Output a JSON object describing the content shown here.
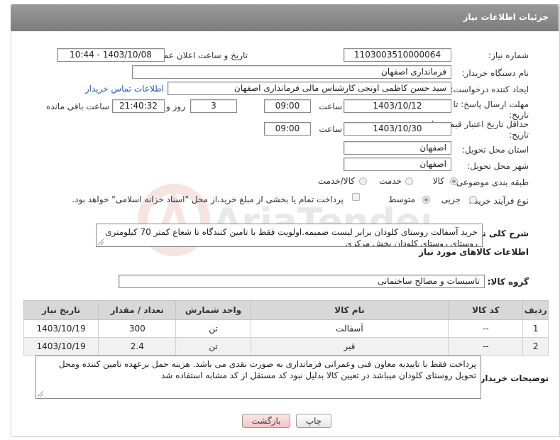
{
  "header": {
    "title": "جزئیات اطلاعات نیاز"
  },
  "fields": {
    "need_number_label": "شماره نیاز:",
    "need_number": "1103003510000064",
    "announce_label": "تاریخ و ساعت اعلان عمومی:",
    "announce_value": "1403/10/08 - 10:44",
    "buyer_org_label": "نام دستگاه خریدار:",
    "buyer_org": "فرمانداری اصفهان",
    "creator_label": "ایجاد کننده درخواست:",
    "creator": "سید حسن  کاظمی اونجی کارشناس مالی  فرمانداری اصفهان",
    "contact_link": "اطلاعات تماس خریدار",
    "reply_deadline_label_1": "مهلت ارسال پاسخ: تا",
    "reply_deadline_label_2": "تاریخ:",
    "reply_date": "1403/10/12",
    "time_label": "ساعت",
    "reply_time": "09:00",
    "days_value": "3",
    "days_label": "روز و",
    "remaining_value": "21:40:32",
    "remaining_label": "ساعت باقی مانده",
    "validity_label_1": "حداقل تاریخ اعتبار قیمت: تا",
    "validity_label_2": "تاریخ:",
    "validity_date": "1403/10/30",
    "validity_time": "09:00",
    "province_label": "استان محل تحویل:",
    "province": "اصفهان",
    "city_label": "شهر محل تحویل:",
    "city": "اصفهان",
    "category_label": "طبقه بندی موضوعی:",
    "category_options": [
      "کالا",
      "خدمت",
      "کالا/خدمت"
    ],
    "purchase_type_label": "نوع فرآیند خرید :",
    "purchase_options": [
      "جزیی",
      "متوسط"
    ],
    "payment_note": "پرداخت تمام یا بخشی از مبلغ خرید،از محل \"اسناد خزانه اسلامی\" خواهد بود.",
    "description_label": "شرح کلی نیاز:",
    "description": "خرید آسفالت روستای کلودان برابر لیست ضمیمه.اولویت فقط با تامین کنندگاه تا شعاع کمتر 70 کیلومتری روستای روستای کلودان  بخش مرکزی",
    "goods_info_title": "اطلاعات کالاهای مورد نیاز",
    "goods_group_label": "گروه کالا:",
    "goods_group": "تاسیسات و مصالح ساختمانی"
  },
  "table": {
    "headers": [
      "ردیف",
      "کد کالا",
      "نام کالا",
      "واحد شمارش",
      "تعداد / مقدار",
      "تاریخ نیاز"
    ],
    "rows": [
      [
        "1",
        "--",
        "آسفالت",
        "تن",
        "300",
        "1403/10/19"
      ],
      [
        "2",
        "--",
        "قیر",
        "تن",
        "2.4",
        "1403/10/19"
      ]
    ]
  },
  "buyer_notes": {
    "label": "توضیحات خریدار:",
    "text": "پرداخت فقط با تاییدیه معاون فنی وعمرانی فرمانداری به صورت نقدی می باشد. هزینه حمل برعهده تامین کننده ومحل تحویل روستای کلودان میباشد در تعیین کالا بدلیل نبود کد مستقل  از کد مشابه استفاده شد"
  },
  "buttons": {
    "print": "چاپ",
    "back": "بازگشت"
  },
  "watermark": {
    "text": "AriaTender.neT"
  }
}
